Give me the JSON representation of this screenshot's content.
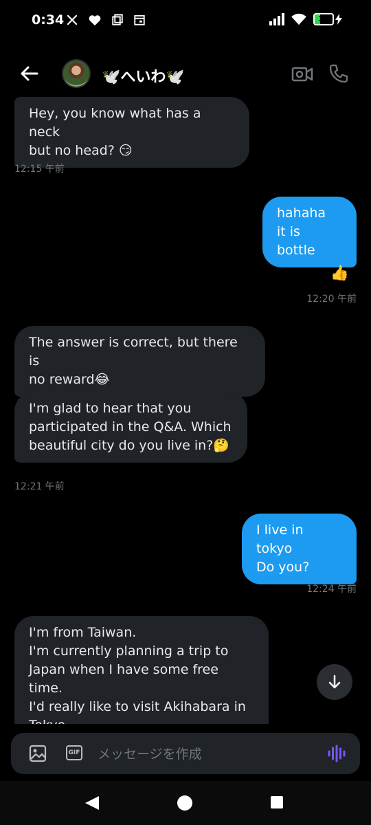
{
  "status_bar": {
    "time": "0:34",
    "battery": "30",
    "battery_level": 0.3,
    "icons_left": [
      "x-logo-icon",
      "heart-icon",
      "copy-icon",
      "calendar-icon"
    ],
    "icons_right": [
      "signal-icon",
      "wifi-icon",
      "battery-icon",
      "charging-icon"
    ]
  },
  "header": {
    "title": "🕊️へいわ🕊️",
    "actions": [
      "video-call-icon",
      "phone-icon"
    ]
  },
  "messages": [
    {
      "id": "m1",
      "direction": "incoming",
      "text": "Hey, you know what has a neck\nbut no head? 😏"
    },
    {
      "id": "t1",
      "type": "timestamp",
      "text": "12:15 午前"
    },
    {
      "id": "m2",
      "direction": "outgoing",
      "text": "hahaha\nit is bottle",
      "reaction": "👍"
    },
    {
      "id": "t2",
      "type": "timestamp",
      "text": "12:20 午前"
    },
    {
      "id": "m3",
      "direction": "incoming",
      "text": "The answer is correct, but there is\nno reward😂"
    },
    {
      "id": "m4",
      "direction": "incoming",
      "text": "I'm glad to hear that you\nparticipated in the Q&A. Which\nbeautiful city do you live in?🤔"
    },
    {
      "id": "t3",
      "type": "timestamp",
      "text": "12:21 午前"
    },
    {
      "id": "m5",
      "direction": "outgoing",
      "text": "I live in tokyo\nDo you?"
    },
    {
      "id": "t4",
      "type": "timestamp",
      "text": "12:24 午前"
    },
    {
      "id": "m6",
      "direction": "incoming",
      "text": "I'm from Taiwan.\nI'm currently planning a trip to\nJapan when I have some free time.\nI'd really like to visit Akihabara in\nTokyo."
    }
  ],
  "composer": {
    "placeholder": "メッセージを作成",
    "gif_label": "GIF",
    "icons": [
      "image-icon",
      "gif-icon",
      "voice-icon"
    ]
  },
  "colors": {
    "background": "#000000",
    "incoming_bubble": "#202327",
    "outgoing_bubble": "#1d9bf0",
    "timestamp": "#71767b",
    "voice_accent": "#7856ff"
  }
}
